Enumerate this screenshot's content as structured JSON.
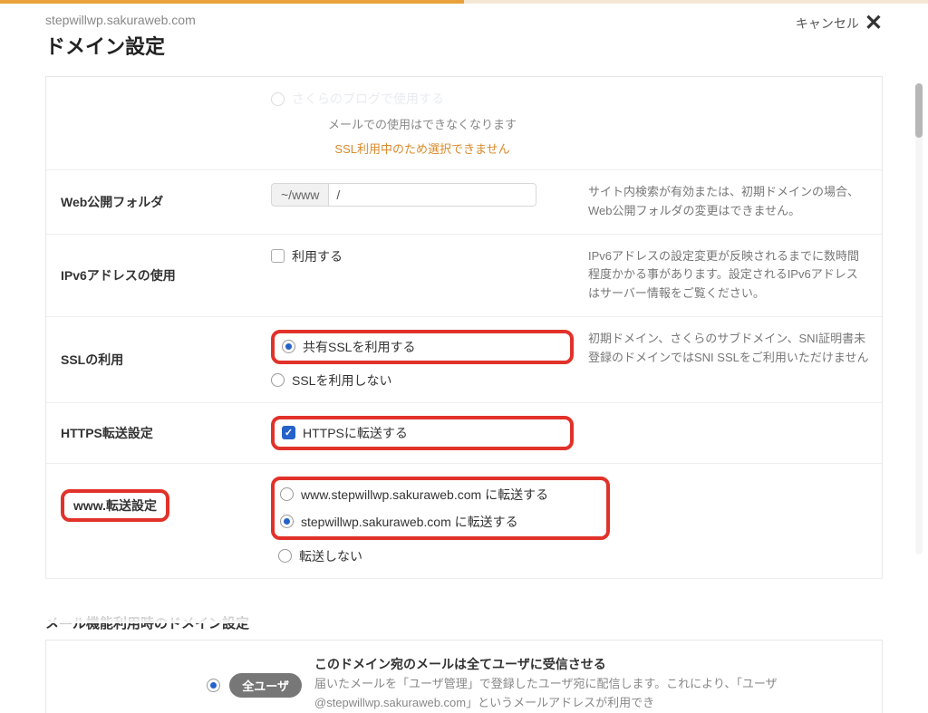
{
  "header": {
    "domain": "stepwillwp.sakuraweb.com",
    "title": "ドメイン設定",
    "cancel_label": "キャンセル"
  },
  "cutoff": {
    "radio_text": "さくらのブログで使用する",
    "note1": "メールでの使用はできなくなります",
    "warn": "SSL利用中のため選択できません"
  },
  "web_folder": {
    "label": "Web公開フォルダ",
    "prefix": "~/www",
    "value": "/",
    "note": "サイト内検索が有効または、初期ドメインの場合、Web公開フォルダの変更はできません。"
  },
  "ipv6": {
    "label": "IPv6アドレスの使用",
    "option": "利用する",
    "note": "IPv6アドレスの設定変更が反映されるまでに数時間程度かかる事があります。設定されるIPv6アドレスはサーバー情報をご覧ください。"
  },
  "ssl": {
    "label": "SSLの利用",
    "opt_use": "共有SSLを利用する",
    "opt_none": "SSLを利用しない",
    "note": "初期ドメイン、さくらのサブドメイン、SNI証明書未登録のドメインではSNI SSLをご利用いただけません"
  },
  "https": {
    "label": "HTTPS転送設定",
    "opt": "HTTPSに転送する"
  },
  "www": {
    "label": "www.転送設定",
    "opt_www": "www.stepwillwp.sakuraweb.com に転送する",
    "opt_root": "stepwillwp.sakuraweb.com に転送する",
    "opt_none": "転送しない"
  },
  "mail_section_title": "メール機能利用時のドメイン設定",
  "mail": {
    "pill": "全ユーザ",
    "title": "このドメイン宛のメールは全てユーザに受信させる",
    "desc": "届いたメールを「ユーザ管理」で登録したユーザ宛に配信します。これにより、「ユーザ@stepwillwp.sakuraweb.com」というメールアドレスが利用でき"
  }
}
